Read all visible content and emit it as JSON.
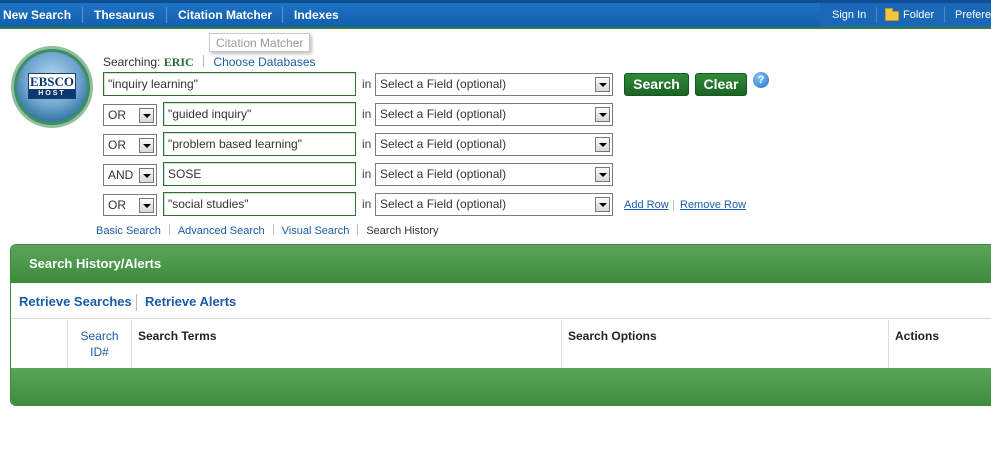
{
  "nav": {
    "new_search": "New Search",
    "thesaurus": "Thesaurus",
    "citation_matcher": "Citation Matcher",
    "indexes": "Indexes",
    "sign_in": "Sign In",
    "folder": "Folder",
    "preferences": "Prefere"
  },
  "tooltip": "Citation Matcher",
  "logo": {
    "main": "EBSCO",
    "sub": "HOST"
  },
  "searching": {
    "label": "Searching:",
    "database": "ERIC",
    "choose": "Choose Databases"
  },
  "rows": [
    {
      "bool": "",
      "term": "\"inquiry learning\"",
      "in": "in",
      "field": "Select a Field (optional)"
    },
    {
      "bool": "OR",
      "term": "\"guided inquiry\"",
      "in": "in",
      "field": "Select a Field (optional)"
    },
    {
      "bool": "OR",
      "term": "\"problem based learning\"",
      "in": "in",
      "field": "Select a Field (optional)"
    },
    {
      "bool": "AND",
      "term": "SOSE",
      "in": "in",
      "field": "Select a Field (optional)"
    },
    {
      "bool": "OR",
      "term": "\"social studies\"",
      "in": "in",
      "field": "Select a Field (optional)"
    }
  ],
  "buttons": {
    "search": "Search",
    "clear": "Clear",
    "help": "?"
  },
  "row_links": {
    "add": "Add Row",
    "remove": "Remove Row"
  },
  "tabs": {
    "basic": "Basic Search",
    "advanced": "Advanced Search",
    "visual": "Visual Search",
    "history": "Search History"
  },
  "history": {
    "title": "Search History/Alerts",
    "retrieve_searches": "Retrieve Searches",
    "retrieve_alerts": "Retrieve Alerts",
    "columns": {
      "search_id": "Search ID#",
      "terms": "Search Terms",
      "options": "Search Options",
      "actions": "Actions"
    }
  }
}
